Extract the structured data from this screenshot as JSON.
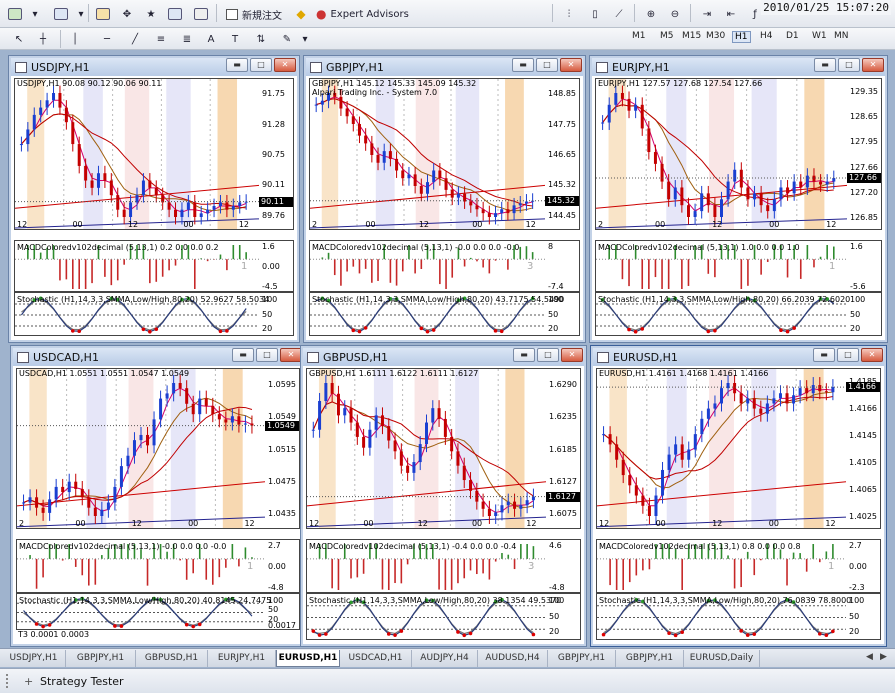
{
  "toolbar": {
    "new_order_label": "新規注文",
    "expert_advisors_label": "Expert Advisors",
    "clock": "2010/01/25 15:07:20"
  },
  "timeframes": [
    "M1",
    "M5",
    "M15",
    "M30",
    "H1",
    "H4",
    "D1",
    "W1",
    "MN"
  ],
  "active_timeframe": "H1",
  "windows": [
    {
      "id": "usdjpy",
      "title": "USDJPY,H1",
      "info": "USDJPY,H1  90.08 90.12 90.06 90.11",
      "macd_info": "MACDColoredv102decimal (5,13,1) 0.2 0.0 0.0 0.2",
      "macd_badge": "1",
      "stoch_info": "Stochastic (H1,14,3,3,SMMA,Low/High,80,20) 52.9627 58.5034",
      "main_labels": [
        "91.75",
        "91.28",
        "90.75",
        "90.11",
        "89.76"
      ],
      "macd_labels": [
        "1.6",
        "0.00",
        "-4.5"
      ],
      "stoch_labels": [
        "100",
        "50",
        "20"
      ],
      "x_labels": [
        "12",
        "00",
        "12",
        "00",
        "12"
      ],
      "last_price": "90.11",
      "price_series": [
        90.9,
        91.1,
        91.3,
        91.4,
        91.5,
        91.6,
        91.4,
        91.2,
        90.9,
        90.6,
        90.4,
        90.3,
        90.5,
        90.4,
        90.2,
        90.0,
        89.9,
        90.1,
        90.2,
        90.4,
        90.3,
        90.2,
        90.1,
        90.0,
        89.9,
        90.0,
        90.1,
        89.9,
        89.95,
        90.0,
        90.05,
        90.1,
        90.0,
        90.05,
        90.1,
        90.11
      ],
      "colors": {
        "up": "#1a3fd1",
        "down": "#c40000"
      }
    },
    {
      "id": "gbpjpy",
      "title": "GBPJPY,H1",
      "info": "GBPJPY,H1  145.12 145.33 145.09 145.32",
      "info2": "Alpari Trading Inc. - System 7.0",
      "macd_info": "MACDColoredv102decimal (5,13,1) -0.0 0.0 0.0 -0.0",
      "macd_badge": "3",
      "stoch_info": "Stochastic (H1,14,3,3,SMMA,Low/High,80,20) 43.7175 54.5490",
      "main_labels": [
        "148.85",
        "147.75",
        "146.65",
        "145.32",
        "144.45"
      ],
      "macd_labels": [
        "8",
        "-7.4"
      ],
      "stoch_labels": [
        "100",
        "50",
        "20"
      ],
      "x_labels": [
        "2",
        "00",
        "12",
        "00",
        "12"
      ],
      "last_price": "145.32",
      "price_series": [
        147.8,
        147.9,
        148.1,
        148.0,
        147.7,
        147.5,
        147.3,
        147.0,
        146.8,
        146.5,
        146.3,
        146.6,
        146.4,
        146.1,
        145.9,
        146.0,
        145.7,
        145.5,
        145.8,
        146.1,
        145.9,
        145.6,
        145.4,
        145.5,
        145.3,
        145.2,
        145.1,
        145.0,
        144.9,
        145.0,
        145.1,
        145.0,
        145.2,
        145.25,
        145.3,
        145.32
      ],
      "colors": {
        "up": "#1a3fd1",
        "down": "#c40000"
      }
    },
    {
      "id": "eurjpy",
      "title": "EURJPY,H1",
      "info": "EURJPY,H1  127.57 127.68 127.54 127.66",
      "macd_info": "MACDColoredv102decimal (5,13,1) 1.0 0.0 0.0 1.0",
      "macd_badge": "1",
      "stoch_info": "Stochastic (H1,14,3,3,SMMA,Low/High,80,20) 66.2039 72.6020",
      "main_labels": [
        "129.35",
        "128.65",
        "127.95",
        "127.66",
        "127.20",
        "126.85"
      ],
      "macd_labels": [
        "1.6",
        "-5.6"
      ],
      "stoch_labels": [
        "100",
        "50",
        "20"
      ],
      "x_labels": [
        "2",
        "00",
        "12",
        "00",
        "12"
      ],
      "last_price": "127.66",
      "price_series": [
        128.6,
        128.9,
        129.1,
        129.0,
        128.8,
        128.9,
        128.5,
        128.1,
        127.9,
        127.6,
        127.3,
        127.5,
        127.2,
        127.0,
        127.1,
        127.4,
        127.2,
        127.0,
        127.3,
        127.6,
        127.8,
        127.5,
        127.3,
        127.4,
        127.2,
        127.1,
        127.3,
        127.5,
        127.4,
        127.6,
        127.5,
        127.7,
        127.6,
        127.55,
        127.6,
        127.66
      ],
      "colors": {
        "up": "#1a3fd1",
        "down": "#c40000"
      }
    },
    {
      "id": "usdcad",
      "title": "USDCAD,H1",
      "info": "USDCAD,H1  1.0551 1.0551 1.0547 1.0549",
      "macd_info": "MACDColoredv102decimal (5,13,1) -0.0 0.0 0.0 -0.0",
      "macd_badge": "1",
      "stoch_info": "Stochastic (H1,14,3,3,SMMA,Low/High,80,20) 40.8145 24.7475",
      "bottom_info": "T3  0.0001  0.0003",
      "main_labels": [
        "1.0595",
        "1.0549",
        "1.0515",
        "1.0475",
        "1.0435"
      ],
      "macd_labels": [
        "2.7",
        "0.00",
        "-4.8"
      ],
      "stoch_labels": [
        "100",
        "50",
        "20",
        "0.0017"
      ],
      "x_labels": [
        "2",
        "00",
        "12",
        "00",
        "12"
      ],
      "last_price": "1.0549",
      "price_series": [
        1.0475,
        1.048,
        1.047,
        1.0465,
        1.0478,
        1.049,
        1.0485,
        1.0495,
        1.0488,
        1.048,
        1.047,
        1.0462,
        1.0468,
        1.0475,
        1.049,
        1.051,
        1.052,
        1.0535,
        1.054,
        1.053,
        1.0555,
        1.0575,
        1.058,
        1.059,
        1.0585,
        1.057,
        1.056,
        1.0575,
        1.0568,
        1.056,
        1.0555,
        1.0552,
        1.0558,
        1.055,
        1.0551,
        1.0549
      ],
      "colors": {
        "up": "#1a3fd1",
        "down": "#c40000"
      }
    },
    {
      "id": "gbpusd",
      "title": "GBPUSD,H1",
      "info": "GBPUSD,H1  1.6111 1.6122 1.6111 1.6127",
      "macd_info": "MACDColoredv102decimal (5,13,1) -0.4 0.0 0.0 -0.4",
      "macd_badge": "3",
      "stoch_info": "Stochastic (H1,14,3,3,SMMA,Low/High,80,20) 38.1354 49.5370",
      "main_labels": [
        "1.6290",
        "1.6235",
        "1.6185",
        "1.6127",
        "1.6075"
      ],
      "macd_labels": [
        "4.6",
        "-4.8"
      ],
      "stoch_labels": [
        "100",
        "50",
        "20"
      ],
      "x_labels": [
        "12",
        "00",
        "12",
        "00",
        "12"
      ],
      "last_price": "1.6127",
      "price_series": [
        1.622,
        1.626,
        1.6285,
        1.627,
        1.624,
        1.625,
        1.623,
        1.621,
        1.6195,
        1.622,
        1.624,
        1.6225,
        1.6205,
        1.619,
        1.617,
        1.616,
        1.6175,
        1.62,
        1.623,
        1.625,
        1.6235,
        1.621,
        1.619,
        1.617,
        1.615,
        1.6135,
        1.612,
        1.611,
        1.61,
        1.6105,
        1.6115,
        1.612,
        1.611,
        1.6115,
        1.6122,
        1.6127
      ],
      "colors": {
        "up": "#1a3fd1",
        "down": "#c40000"
      }
    },
    {
      "id": "eurusd",
      "title": "EURUSD,H1",
      "info": "EURUSD,H1  1.4161 1.4168 1.4161 1.4166",
      "macd_info": "MACDColoredv102decimal (5,13,1) 0.8 0.0 0.0 0.8",
      "macd_badge": "1",
      "stoch_info": "Stochastic (H1,14,3,3,SMMA,Low/High,80,20) 76.0839 78.8000",
      "main_labels": [
        "1.4185",
        "1.4166",
        "1.4145",
        "1.4105",
        "1.4065",
        "1.4025"
      ],
      "macd_labels": [
        "2.7",
        "0.00",
        "-2.3"
      ],
      "stoch_labels": [
        "100",
        "50",
        "20"
      ],
      "x_labels": [
        "12",
        "00",
        "12",
        "00",
        "12"
      ],
      "last_price": "1.4166",
      "price_series": [
        1.412,
        1.411,
        1.4095,
        1.408,
        1.407,
        1.406,
        1.405,
        1.404,
        1.406,
        1.4085,
        1.41,
        1.411,
        1.4095,
        1.4105,
        1.412,
        1.4135,
        1.4145,
        1.415,
        1.4165,
        1.417,
        1.416,
        1.415,
        1.4155,
        1.4145,
        1.414,
        1.415,
        1.4155,
        1.416,
        1.415,
        1.4158,
        1.4165,
        1.416,
        1.4168,
        1.4162,
        1.4161,
        1.4166
      ],
      "colors": {
        "up": "#1a3fd1",
        "down": "#c40000"
      }
    }
  ],
  "tabs": [
    "USDJPY,H1",
    "GBPJPY,H1",
    "GBPUSD,H1",
    "EURJPY,H1",
    "EURUSD,H1",
    "USDCAD,H1",
    "AUDJPY,H4",
    "AUDUSD,H4",
    "GBPJPY,H1",
    "GBPJPY,H1",
    "EURUSD,Daily"
  ],
  "active_tab": "EURUSD,H1",
  "tester_label": "Strategy Tester"
}
